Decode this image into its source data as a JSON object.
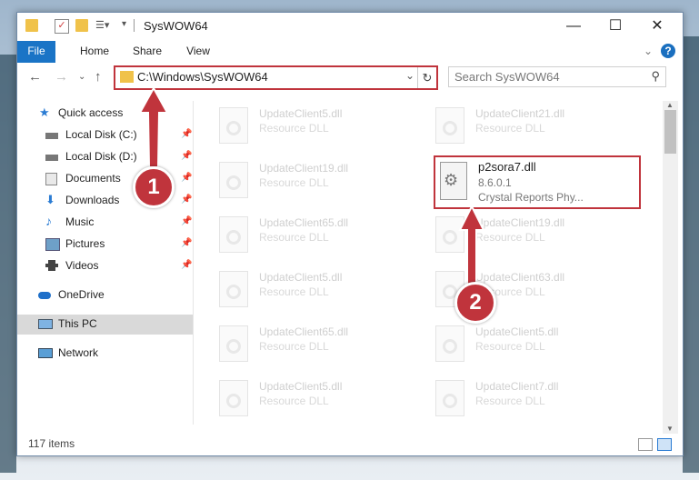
{
  "window": {
    "title": "SysWOW64"
  },
  "ribbon": {
    "tabs": [
      "File",
      "Home",
      "Share",
      "View"
    ]
  },
  "address": {
    "path": "C:\\Windows\\SysWOW64"
  },
  "search": {
    "placeholder": "Search SysWOW64"
  },
  "sidebar": {
    "items": [
      {
        "label": "Quick access",
        "icon": "star-icon"
      },
      {
        "label": "Local Disk (C:)",
        "icon": "drive-icon",
        "pinned": true
      },
      {
        "label": "Local Disk (D:)",
        "icon": "drive-icon",
        "pinned": true
      },
      {
        "label": "Documents",
        "icon": "documents-icon",
        "pinned": true
      },
      {
        "label": "Downloads",
        "icon": "download-icon",
        "pinned": true
      },
      {
        "label": "Music",
        "icon": "music-icon",
        "pinned": true
      },
      {
        "label": "Pictures",
        "icon": "pictures-icon",
        "pinned": true
      },
      {
        "label": "Videos",
        "icon": "videos-icon",
        "pinned": true
      },
      {
        "label": "OneDrive",
        "icon": "cloud-icon"
      },
      {
        "label": "This PC",
        "icon": "computer-icon",
        "selected": true
      },
      {
        "label": "Network",
        "icon": "network-icon"
      }
    ]
  },
  "files": {
    "left": [
      {
        "name": "UpdateClient5.dll",
        "type": "Resource DLL"
      },
      {
        "name": "UpdateClient19.dll",
        "type": "Resource DLL"
      },
      {
        "name": "UpdateClient65.dll",
        "type": "Resource DLL"
      },
      {
        "name": "UpdateClient5.dll",
        "type": "Resource DLL"
      },
      {
        "name": "UpdateClient65.dll",
        "type": "Resource DLL"
      },
      {
        "name": "UpdateClient5.dll",
        "type": "Resource DLL"
      }
    ],
    "right": [
      {
        "name": "UpdateClient21.dll",
        "type": "Resource DLL"
      },
      {
        "name": "UpdateClient19.dll",
        "type": "Resource DLL"
      },
      {
        "name": "UpdateClient63.dll",
        "type": "Resource DLL"
      },
      {
        "name": "UpdateClient5.dll",
        "type": "Resource DLL"
      },
      {
        "name": "UpdateClient7.dll",
        "type": "Resource DLL"
      }
    ],
    "highlighted": {
      "name": "p2sora7.dll",
      "version": "8.6.0.1",
      "description": "Crystal Reports Phy..."
    }
  },
  "status": {
    "items": "117 items"
  },
  "annotations": {
    "step1": "1",
    "step2": "2",
    "color": "#c0343c"
  }
}
